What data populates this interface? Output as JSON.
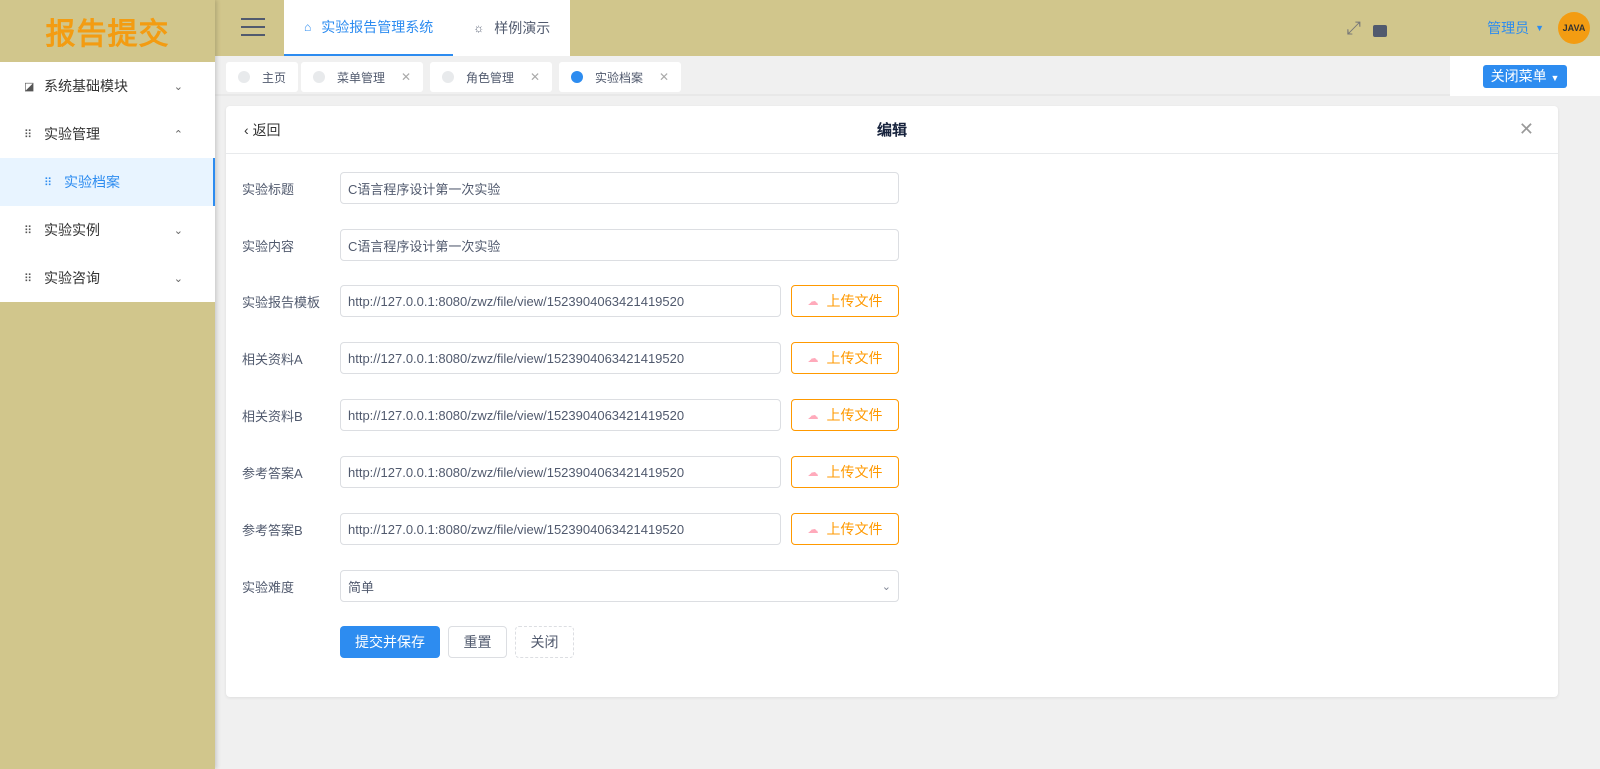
{
  "logo": "报告提交",
  "sidebar": {
    "items": [
      {
        "label": "系统基础模块"
      },
      {
        "label": "实验管理"
      },
      {
        "label": "实验档案"
      },
      {
        "label": "实验实例"
      },
      {
        "label": "实验咨询"
      }
    ]
  },
  "topnav": [
    {
      "label": "实验报告管理系统"
    },
    {
      "label": "样例演示"
    }
  ],
  "user": {
    "name": "管理员",
    "avatar_text": "JAVA"
  },
  "tags": [
    {
      "label": "主页"
    },
    {
      "label": "菜单管理"
    },
    {
      "label": "角色管理"
    },
    {
      "label": "实验档案"
    }
  ],
  "close_menu": "关闭菜单",
  "form": {
    "back": "返回",
    "title": "编辑",
    "fields": [
      {
        "label": "实验标题",
        "value": "C语言程序设计第一次实验"
      },
      {
        "label": "实验内容",
        "value": "C语言程序设计第一次实验"
      },
      {
        "label": "实验报告模板",
        "value": "http://127.0.0.1:8080/zwz/file/view/1523904063421419520",
        "upload": "上传文件"
      },
      {
        "label": "相关资料A",
        "value": "http://127.0.0.1:8080/zwz/file/view/1523904063421419520",
        "upload": "上传文件"
      },
      {
        "label": "相关资料B",
        "value": "http://127.0.0.1:8080/zwz/file/view/1523904063421419520",
        "upload": "上传文件"
      },
      {
        "label": "参考答案A",
        "value": "http://127.0.0.1:8080/zwz/file/view/1523904063421419520",
        "upload": "上传文件"
      },
      {
        "label": "参考答案B",
        "value": "http://127.0.0.1:8080/zwz/file/view/1523904063421419520",
        "upload": "上传文件"
      },
      {
        "label": "实验难度",
        "value": "简单"
      }
    ],
    "submit": "提交并保存",
    "reset": "重置",
    "close": "关闭"
  },
  "colors": {
    "accent": "#2d8cf0",
    "header_bg": "#d1c68c",
    "upload": "#ff9900"
  }
}
